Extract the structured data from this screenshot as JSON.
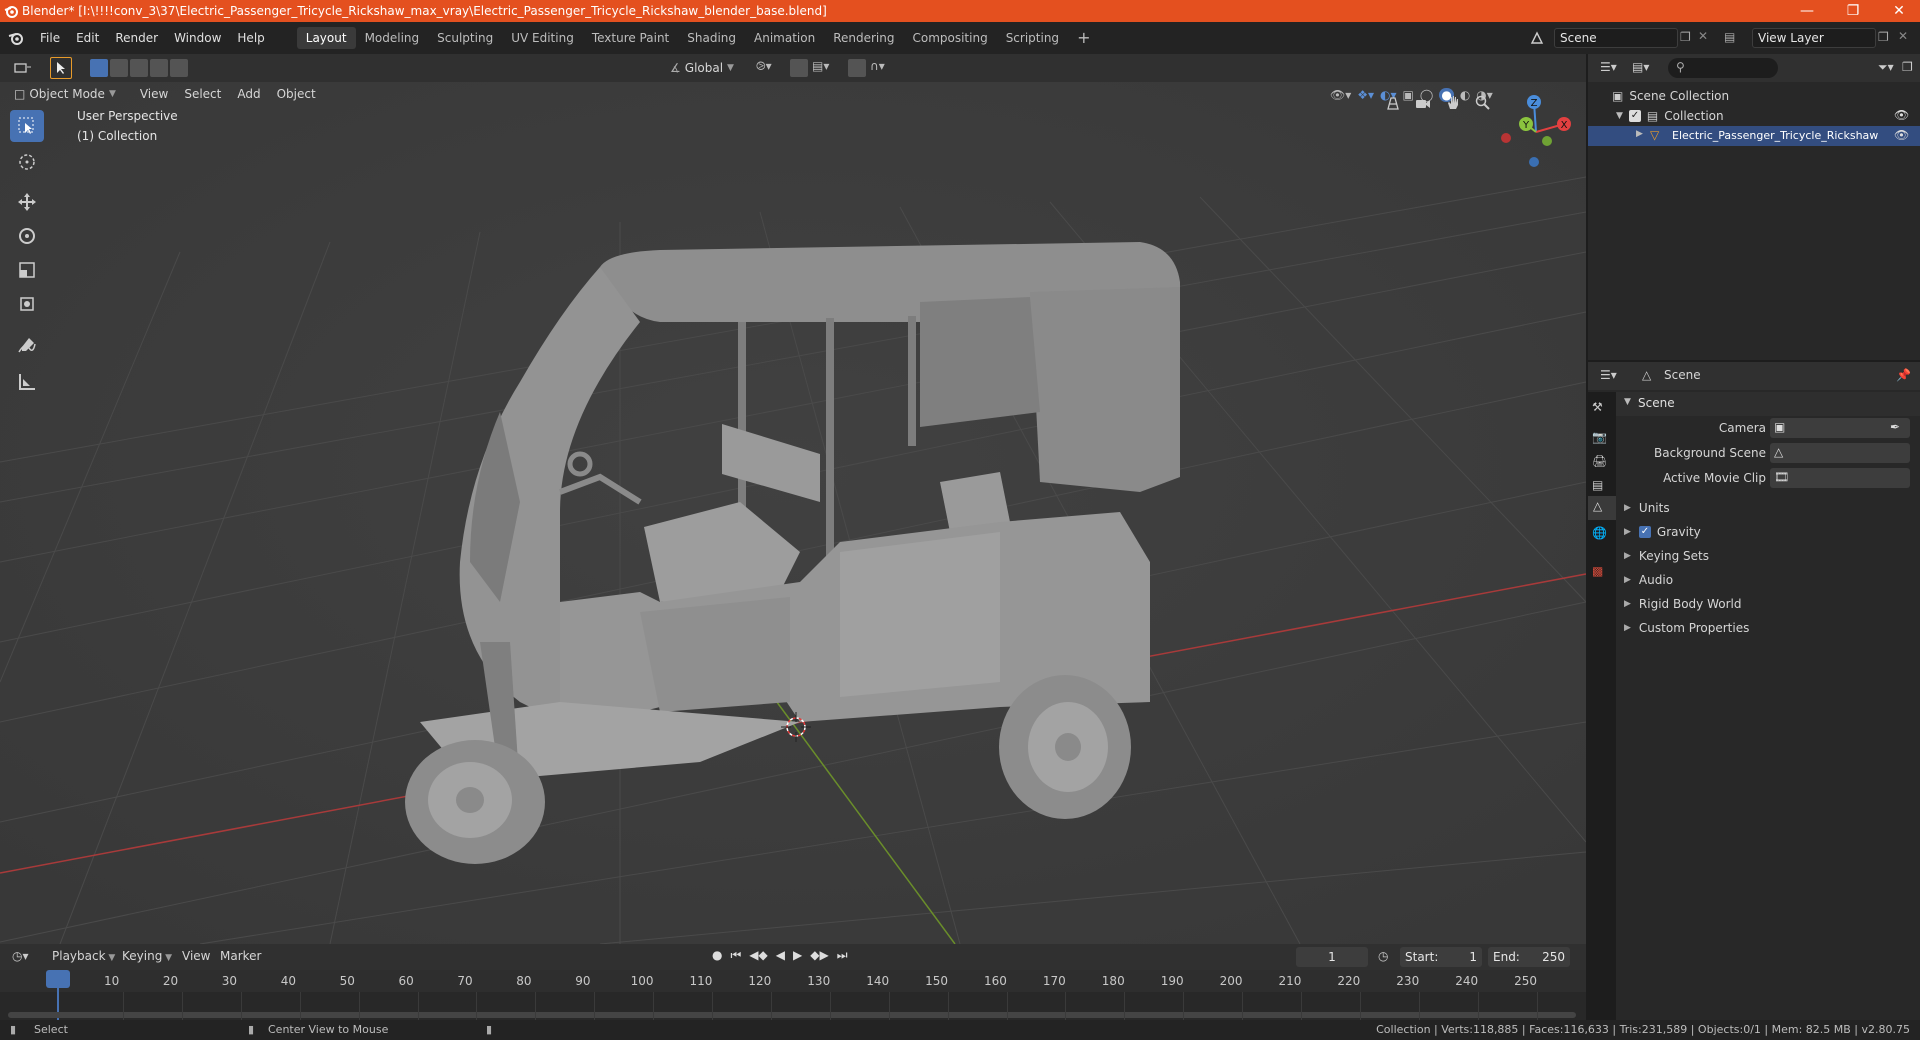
{
  "title": "Blender* [I:\\!!!!conv_3\\37\\Electric_Passenger_Tricycle_Rickshaw_max_vray\\Electric_Passenger_Tricycle_Rickshaw_blender_base.blend]",
  "menu": [
    "File",
    "Edit",
    "Render",
    "Window",
    "Help"
  ],
  "workspaces": [
    "Layout",
    "Modeling",
    "Sculpting",
    "UV Editing",
    "Texture Paint",
    "Shading",
    "Animation",
    "Rendering",
    "Compositing",
    "Scripting"
  ],
  "active_workspace": "Layout",
  "scene_field": "Scene",
  "view_layer_field": "View Layer",
  "toolheader": {
    "orientation": "Global"
  },
  "viewport_header": {
    "mode": "Object Mode",
    "menus": [
      "View",
      "Select",
      "Add",
      "Object"
    ]
  },
  "viewport": {
    "perspective": "User Perspective",
    "collection": "(1) Collection"
  },
  "gizmo": {
    "x": "X",
    "y": "Y",
    "z": "Z"
  },
  "outliner": {
    "root": "Scene Collection",
    "collection": "Collection",
    "object": "Electric_Passenger_Tricycle_Rickshaw_max"
  },
  "properties": {
    "header": "Scene",
    "panel": "Scene",
    "fields": [
      {
        "label": "Camera",
        "value": ""
      },
      {
        "label": "Background Scene",
        "value": ""
      },
      {
        "label": "Active Movie Clip",
        "value": ""
      }
    ],
    "sections": [
      "Units",
      "Gravity",
      "Keying Sets",
      "Audio",
      "Rigid Body World",
      "Custom Properties"
    ],
    "gravity_checked": true
  },
  "timeline": {
    "menus": [
      "Playback",
      "Keying",
      "View",
      "Marker"
    ],
    "current_frame": "1",
    "start_label": "Start:",
    "start": "1",
    "end_label": "End:",
    "end": "250",
    "ticks": [
      "1",
      "10",
      "20",
      "30",
      "40",
      "50",
      "60",
      "70",
      "80",
      "90",
      "100",
      "110",
      "120",
      "130",
      "140",
      "150",
      "160",
      "170",
      "180",
      "190",
      "200",
      "210",
      "220",
      "230",
      "240",
      "250"
    ]
  },
  "status": {
    "left": "Select",
    "middle": "Center View to Mouse",
    "right": "Collection | Verts:118,885 | Faces:116,633 | Tris:231,589 | Objects:0/1 | Mem: 82.5 MB | v2.80.75"
  },
  "colors": {
    "titlebar": "#e4501f",
    "accent": "#4772b3",
    "x_axis": "#e24040",
    "y_axis": "#8bc43e",
    "z_axis": "#4a8ddb"
  }
}
